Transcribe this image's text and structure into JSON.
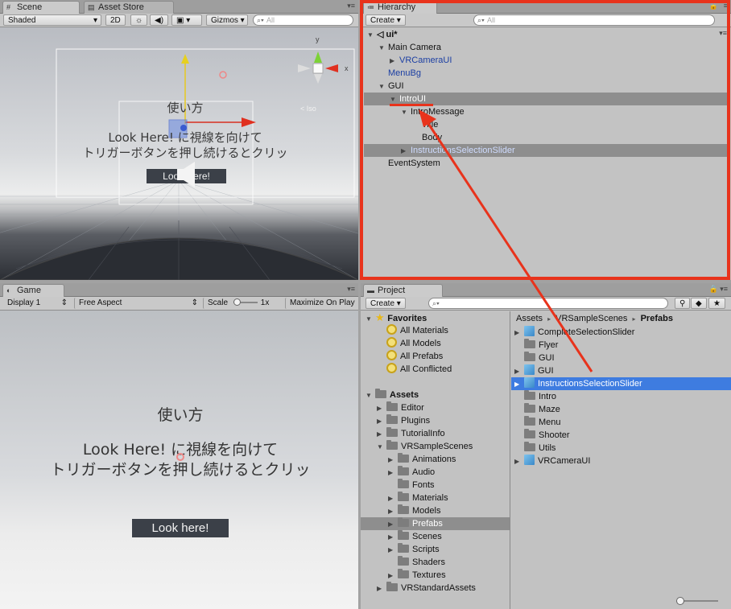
{
  "scene": {
    "tabs": [
      {
        "icon": "#",
        "label": "Scene"
      },
      {
        "icon": "▤",
        "label": "Asset Store"
      }
    ],
    "shading": "Shaded",
    "mode2d": "2D",
    "gizmos": "Gizmos",
    "search_placeholder": "All",
    "view": {
      "title": "使い方",
      "line1": "Look Here! に視線を向けて",
      "line2": "トリガーボタンを押し続けるとクリッ",
      "button": "Look Here!",
      "gizmo_x": "x",
      "gizmo_y": "y",
      "persp": "< Iso"
    }
  },
  "hierarchy": {
    "tab": "Hierarchy",
    "create": "Create",
    "search_placeholder": "All",
    "items": [
      {
        "label": "ui*",
        "depth": 0,
        "arrow": "▼",
        "bold": true
      },
      {
        "label": "Main Camera",
        "depth": 1,
        "arrow": "▼"
      },
      {
        "label": "VRCameraUI",
        "depth": 2,
        "arrow": "▶",
        "blue": true
      },
      {
        "label": "MenuBg",
        "depth": 1,
        "arrow": "",
        "blue": true
      },
      {
        "label": "GUI",
        "depth": 1,
        "arrow": "▼"
      },
      {
        "label": "IntroUI",
        "depth": 2,
        "arrow": "▼",
        "selected": true
      },
      {
        "label": "IntroMessage",
        "depth": 3,
        "arrow": "▼"
      },
      {
        "label": "Title",
        "depth": 4,
        "arrow": ""
      },
      {
        "label": "Body",
        "depth": 4,
        "arrow": ""
      },
      {
        "label": "InstructionsSelectionSlider",
        "depth": 3,
        "arrow": "▶",
        "blue": true,
        "selected": true
      },
      {
        "label": "EventSystem",
        "depth": 1,
        "arrow": ""
      }
    ]
  },
  "game": {
    "tab": "Game",
    "display": "Display 1",
    "aspect": "Free Aspect",
    "scale_label": "Scale",
    "scale_value": "1x",
    "maximize": "Maximize On Play",
    "view": {
      "title": "使い方",
      "line1": "Look Here! に視線を向けて",
      "line2": "トリガーボタンを押し続けるとクリッ",
      "button": "Look here!"
    }
  },
  "project": {
    "tab": "Project",
    "create": "Create",
    "tree": [
      {
        "label": "Favorites",
        "depth": 0,
        "arrow": "▼",
        "type": "star",
        "bold": true
      },
      {
        "label": "All Materials",
        "depth": 1,
        "arrow": "",
        "type": "search"
      },
      {
        "label": "All Models",
        "depth": 1,
        "arrow": "",
        "type": "search"
      },
      {
        "label": "All Prefabs",
        "depth": 1,
        "arrow": "",
        "type": "search"
      },
      {
        "label": "All Conflicted",
        "depth": 1,
        "arrow": "",
        "type": "search"
      },
      {
        "label": "",
        "depth": 0,
        "arrow": "",
        "type": "none"
      },
      {
        "label": "Assets",
        "depth": 0,
        "arrow": "▼",
        "type": "folder",
        "bold": true
      },
      {
        "label": "Editor",
        "depth": 1,
        "arrow": "▶",
        "type": "folder"
      },
      {
        "label": "Plugins",
        "depth": 1,
        "arrow": "▶",
        "type": "folder"
      },
      {
        "label": "TutorialInfo",
        "depth": 1,
        "arrow": "▶",
        "type": "folder"
      },
      {
        "label": "VRSampleScenes",
        "depth": 1,
        "arrow": "▼",
        "type": "folder"
      },
      {
        "label": "Animations",
        "depth": 2,
        "arrow": "▶",
        "type": "folder"
      },
      {
        "label": "Audio",
        "depth": 2,
        "arrow": "▶",
        "type": "folder"
      },
      {
        "label": "Fonts",
        "depth": 2,
        "arrow": "",
        "type": "folder"
      },
      {
        "label": "Materials",
        "depth": 2,
        "arrow": "▶",
        "type": "folder"
      },
      {
        "label": "Models",
        "depth": 2,
        "arrow": "▶",
        "type": "folder"
      },
      {
        "label": "Prefabs",
        "depth": 2,
        "arrow": "▶",
        "type": "folder",
        "selected": true
      },
      {
        "label": "Scenes",
        "depth": 2,
        "arrow": "▶",
        "type": "folder"
      },
      {
        "label": "Scripts",
        "depth": 2,
        "arrow": "▶",
        "type": "folder"
      },
      {
        "label": "Shaders",
        "depth": 2,
        "arrow": "",
        "type": "folder"
      },
      {
        "label": "Textures",
        "depth": 2,
        "arrow": "▶",
        "type": "folder"
      },
      {
        "label": "VRStandardAssets",
        "depth": 1,
        "arrow": "▶",
        "type": "folder"
      }
    ],
    "breadcrumb": [
      "Assets",
      "VRSampleScenes",
      "Prefabs"
    ],
    "files": [
      {
        "label": "CompleteSelectionSlider",
        "arrow": "▶",
        "type": "prefab"
      },
      {
        "label": "Flyer",
        "arrow": "",
        "type": "folder"
      },
      {
        "label": "GUI",
        "arrow": "",
        "type": "folder"
      },
      {
        "label": "GUI",
        "arrow": "▶",
        "type": "prefab"
      },
      {
        "label": "InstructionsSelectionSlider",
        "arrow": "▶",
        "type": "prefab",
        "selected": true
      },
      {
        "label": "Intro",
        "arrow": "",
        "type": "folder"
      },
      {
        "label": "Maze",
        "arrow": "",
        "type": "folder"
      },
      {
        "label": "Menu",
        "arrow": "",
        "type": "folder"
      },
      {
        "label": "Shooter",
        "arrow": "",
        "type": "folder"
      },
      {
        "label": "Utils",
        "arrow": "",
        "type": "folder"
      },
      {
        "label": "VRCameraUI",
        "arrow": "▶",
        "type": "prefab"
      }
    ]
  },
  "colors": {
    "highlight": "#e8331c",
    "selected_blue": "#3e7ce0",
    "selected_gray": "#8e8e8e",
    "prefab_text": "#1c3fa3"
  }
}
